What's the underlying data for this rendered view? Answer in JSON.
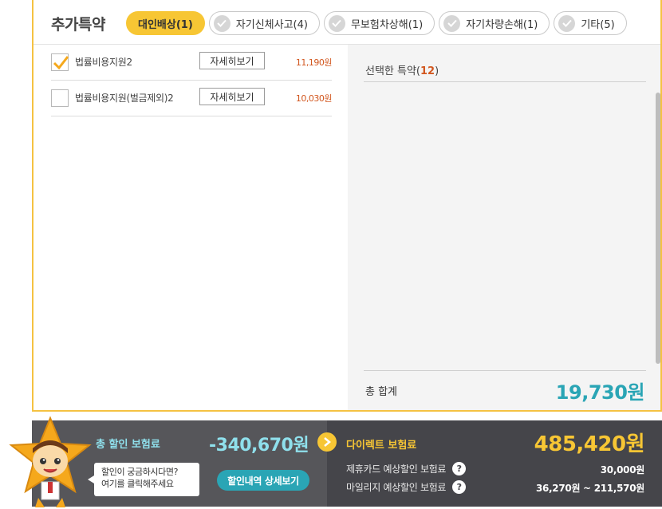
{
  "header": {
    "title": "추가특약",
    "tabs": [
      {
        "label": "대인배상(1)",
        "active": true
      },
      {
        "label": "자기신체사고(4)",
        "active": false
      },
      {
        "label": "무보험차상해(1)",
        "active": false
      },
      {
        "label": "자기차량손해(1)",
        "active": false
      },
      {
        "label": "기타(5)",
        "active": false
      }
    ]
  },
  "options": [
    {
      "name": "법률비용지원2",
      "detail_label": "자세히보기",
      "price": "11,190원",
      "checked": true
    },
    {
      "name": "법률비용지원(벌금제외)2",
      "detail_label": "자세히보기",
      "price": "10,030원",
      "checked": false
    }
  ],
  "selected": {
    "label": "선택한 특약(",
    "count": "12",
    "close": ")"
  },
  "total": {
    "label": "총 합계",
    "value": "19,730원"
  },
  "discount": {
    "label": "총 할인 보험료",
    "value": "-340,670원",
    "bubble_line1": "할인이 궁금하시다면?",
    "bubble_line2": "여기를 클릭해주세요",
    "detail_button": "할인내역 상세보기"
  },
  "direct": {
    "label": "다이렉트 보험료",
    "value": "485,420원",
    "card_label": "제휴카드 예상할인 보험료",
    "card_value": "30,000원",
    "mileage_label": "마일리지 예상할인 보험료",
    "mileage_value": "36,270원 ~ 211,570원",
    "help_glyph": "?"
  },
  "colors": {
    "accent": "#f7c634",
    "teal": "#2aa5b5",
    "price": "#d2571f"
  }
}
